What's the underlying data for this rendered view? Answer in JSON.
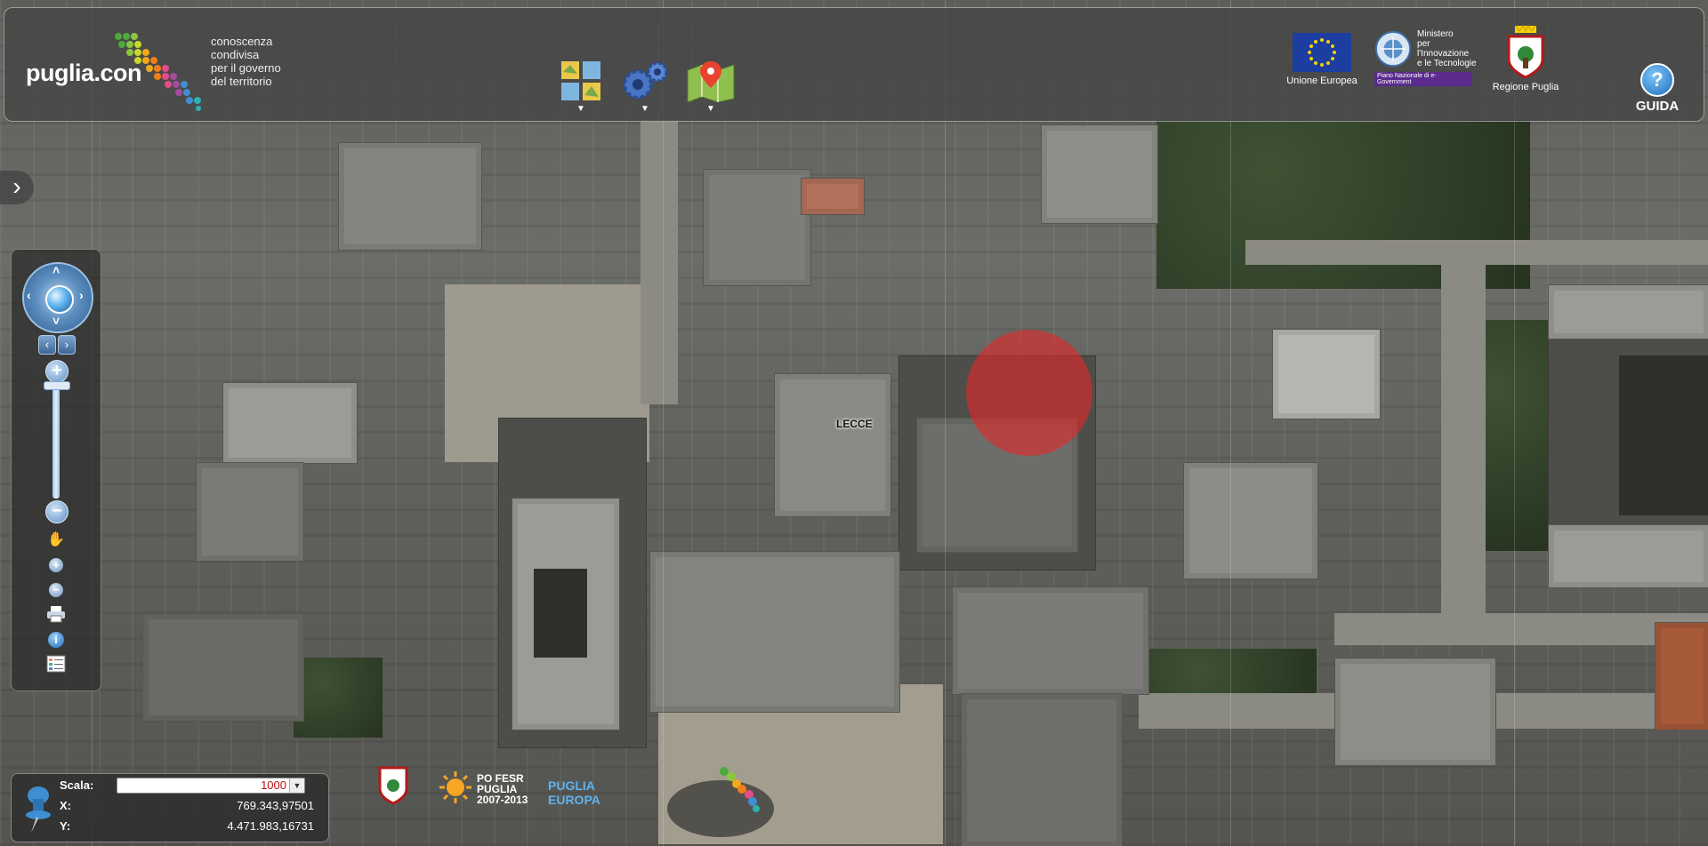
{
  "header": {
    "brand_name": "puglia.con",
    "brand_tagline": [
      "conoscenza",
      "condivisa",
      "per il governo",
      "del territorio"
    ],
    "tools": [
      {
        "icon": "layers-icon"
      },
      {
        "icon": "settings-gears-icon"
      },
      {
        "icon": "map-pin-icon"
      }
    ],
    "logos": {
      "eu": "Unione Europea",
      "ministero_lines": [
        "Ministero",
        "per l'Innovazione",
        "e le Tecnologie"
      ],
      "ministero_sub": "Piano Nazionale di e-Government",
      "regione": "Regione Puglia"
    },
    "help_label": "GUIDA"
  },
  "map": {
    "city_label": "LECCE"
  },
  "nav": {
    "zoom_in": "+",
    "zoom_out": "−"
  },
  "footer": {
    "logos": [
      "PO FESR PUGLIA 2007-2013",
      "PUGLIA EUROPA"
    ]
  },
  "coords": {
    "scala_label": "Scala:",
    "scala_value": "1000",
    "x_label": "X:",
    "x_value": "769.343,97501",
    "y_label": "Y:",
    "y_value": "4.471.983,16731"
  },
  "colors": {
    "marker": "#e22828",
    "scala_text": "#c01010",
    "panel_bg": "#464646"
  }
}
